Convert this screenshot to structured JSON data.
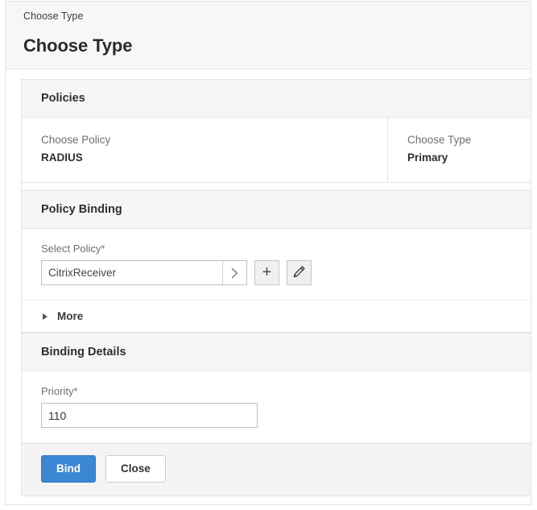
{
  "header": {
    "breadcrumb": "Choose Type",
    "title": "Choose Type"
  },
  "policies": {
    "section_title": "Policies",
    "cells": [
      {
        "label": "Choose Policy",
        "value": "RADIUS"
      },
      {
        "label": "Choose Type",
        "value": "Primary"
      }
    ]
  },
  "policy_binding": {
    "section_title": "Policy Binding",
    "select_policy": {
      "label": "Select Policy*",
      "value": "CitrixReceiver",
      "placeholder": "",
      "browse_icon": "chevron-right-icon",
      "add_icon": "plus-icon",
      "edit_icon": "pencil-icon"
    },
    "more": {
      "label": "More",
      "caret_icon": "caret-right-icon",
      "expanded": false
    },
    "binding_details": {
      "section_title": "Binding Details",
      "priority": {
        "label": "Priority*",
        "value": "110",
        "placeholder": ""
      }
    }
  },
  "actions": {
    "bind_label": "Bind",
    "close_label": "Close"
  },
  "colors": {
    "primary_button": "#3b87d4",
    "panel_background": "#f6f6f6",
    "border": "#e4e4e4"
  }
}
